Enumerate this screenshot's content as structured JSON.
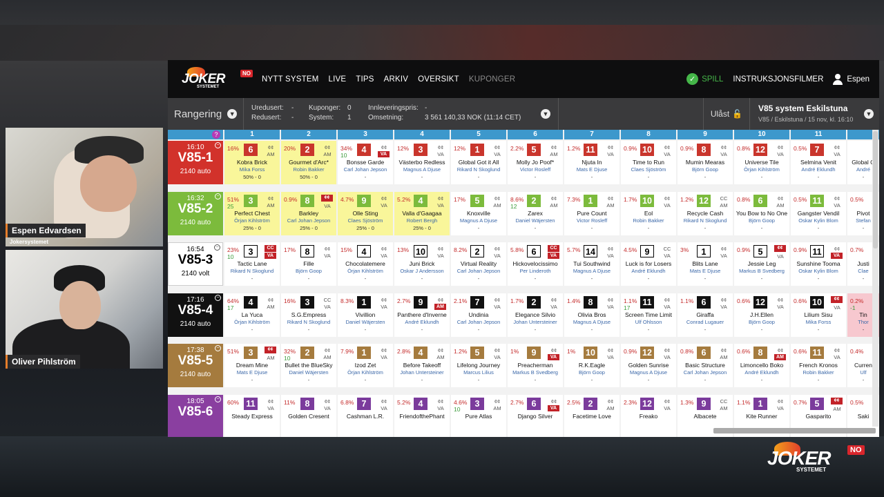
{
  "topbar": {
    "logo_text": "JOKER",
    "logo_sub": "SYSTEMET",
    "logo_badge": "NO",
    "nav": [
      "NYTT SYSTEM",
      "LIVE",
      "TIPS",
      "ARKIV",
      "OVERSIKT",
      "KUPONGER"
    ],
    "spill": "SPILL",
    "instr": "INSTRUKSJONSFILMER",
    "user": "Espen"
  },
  "subbar": {
    "rangering": "Rangering",
    "stats": {
      "uredusert_k": "Uredusert:",
      "uredusert_v": "-",
      "redusert_k": "Redusert:",
      "redusert_v": "-",
      "kuponger_k": "Kuponger:",
      "kuponger_v": "0",
      "system_k": "System:",
      "system_v": "1",
      "innlev_k": "Innleveringspris:",
      "innlev_v": "-",
      "oms_k": "Omsetning:",
      "oms_v": "3 561 140,33 NOK (11:14 CET)"
    },
    "ulast": "Ulåst",
    "system_title": "V85 system Eskilstuna",
    "system_sub": "V85 / Eskilstuna / 15 nov, kl. 16:10"
  },
  "columns": [
    "1",
    "2",
    "3",
    "4",
    "5",
    "6",
    "7",
    "8",
    "9",
    "10",
    "11"
  ],
  "qmark": "?",
  "races": [
    {
      "time": "16:10",
      "name": "V85-1",
      "dist": "2140 auto",
      "color": "#d2322b",
      "cells": [
        {
          "pct": "16%",
          "num": "6",
          "nc": "#c9352c",
          "sh": "¢¢ AM",
          "hn": "Kobra Brick",
          "dn": "Mika Forss",
          "ex": "50% - 0",
          "bg": "y"
        },
        {
          "pct": "20%",
          "num": "2",
          "nc": "#c9352c",
          "sh": "¢¢ AM",
          "hn": "Gourmet d'Arc*",
          "dn": "Robin Bakker",
          "ex": "50% - 0",
          "bg": "y"
        },
        {
          "pct": "34%",
          "pct2": "10",
          "num": "4",
          "nc": "#c9352c",
          "sh": "¢¢",
          "tag": "VA",
          "hn": "Bonsse Garde",
          "dn": "Carl Johan Jepson",
          "ex": "-"
        },
        {
          "pct": "12%",
          "num": "3",
          "nc": "#c9352c",
          "sh": "¢¢ VA",
          "hn": "Västerbo Redless",
          "dn": "Magnus A Djuse",
          "ex": "-"
        },
        {
          "pct": "12%",
          "num": "1",
          "nc": "#c9352c",
          "sh": "¢¢ VA",
          "hn": "Global Got it All",
          "dn": "Rikard N Skoglund",
          "ex": "-"
        },
        {
          "pct": "2.2%",
          "num": "5",
          "nc": "#c9352c",
          "sh": "¢¢ AM",
          "hn": "Molly Jo Poof*",
          "dn": "Victor Rosleff",
          "ex": "-"
        },
        {
          "pct": "1.2%",
          "num": "11",
          "nc": "#c9352c",
          "sh": "¢¢ VA",
          "hn": "Njuta In",
          "dn": "Mats E Djuse",
          "ex": "-"
        },
        {
          "pct": "0.9%",
          "num": "10",
          "nc": "#c9352c",
          "sh": "¢¢ VA",
          "hn": "Time to Run",
          "dn": "Claes Sjöström",
          "ex": "-"
        },
        {
          "pct": "0.9%",
          "num": "8",
          "nc": "#c9352c",
          "sh": "¢¢ VA",
          "hn": "Mumin Mearas",
          "dn": "Björn Goop",
          "ex": "-"
        },
        {
          "pct": "0.8%",
          "num": "12",
          "nc": "#c9352c",
          "sh": "¢¢ VA",
          "hn": "Universe Tile",
          "dn": "Örjan Kihlström",
          "ex": "-"
        },
        {
          "pct": "0.5%",
          "num": "7",
          "nc": "#c9352c",
          "sh": "¢¢ VA",
          "hn": "Selmina Venit",
          "dn": "André Eklundh",
          "ex": "-"
        },
        {
          "pct": "",
          "num": "",
          "nc": "#c9352c",
          "sh": "",
          "hn": "Global G",
          "dn": "André",
          "ex": "-"
        }
      ]
    },
    {
      "time": "16:32",
      "name": "V85-2",
      "dist": "2140 auto",
      "color": "#7cbb3c",
      "cells": [
        {
          "pct": "51%",
          "pct2": "25",
          "num": "3",
          "nc": "#7cbb3c",
          "sh": "¢¢ AM",
          "hn": "Perfect Chest",
          "dn": "Örjan Kihlström",
          "ex": "25% - 0",
          "bg": "y"
        },
        {
          "pct": "0.9%",
          "num": "8",
          "nc": "#7cbb3c",
          "tagt": "¢¢",
          "sh": "",
          "tag2": "VA",
          "hn": "Barkley",
          "dn": "Carl Johan Jepson",
          "ex": "25% - 0",
          "bg": "y"
        },
        {
          "pct": "4.7%",
          "num": "9",
          "nc": "#7cbb3c",
          "sh": "¢¢ VA",
          "hn": "Olle Sting",
          "dn": "Claes Sjöström",
          "ex": "25% - 0",
          "bg": "y"
        },
        {
          "pct": "5.2%",
          "num": "4",
          "nc": "#7cbb3c",
          "sh": "¢¢ VA",
          "hn": "Valla d'Gaagaa",
          "dn": "Robert Bergh",
          "ex": "25% - 0",
          "bg": "y"
        },
        {
          "pct": "17%",
          "num": "5",
          "nc": "#7cbb3c",
          "sh": "¢¢ AM",
          "hn": "Knoxville",
          "dn": "Magnus A Djuse",
          "ex": "-"
        },
        {
          "pct": "8.6%",
          "pct2": "12",
          "num": "2",
          "nc": "#7cbb3c",
          "sh": "¢¢ AM",
          "hn": "Zarex",
          "dn": "Daniel Wäjersten",
          "ex": "-"
        },
        {
          "pct": "7.3%",
          "num": "1",
          "nc": "#7cbb3c",
          "sh": "¢¢ AM",
          "hn": "Pure Count",
          "dn": "Victor Rosleff",
          "ex": "-"
        },
        {
          "pct": "1.7%",
          "num": "10",
          "nc": "#7cbb3c",
          "sh": "¢¢ VA",
          "hn": "Eol",
          "dn": "Robin Bakker",
          "ex": "-"
        },
        {
          "pct": "1.2%",
          "num": "12",
          "nc": "#7cbb3c",
          "sh": "CC AM",
          "hn": "Recycle Cash",
          "dn": "Rikard N Skoglund",
          "ex": "-"
        },
        {
          "pct": "0.8%",
          "num": "6",
          "nc": "#7cbb3c",
          "sh": "¢¢ AM",
          "hn": "You Bow to No One",
          "dn": "Björn Goop",
          "ex": "-"
        },
        {
          "pct": "0.5%",
          "num": "11",
          "nc": "#7cbb3c",
          "sh": "¢¢ VA",
          "hn": "Gangster Vendil",
          "dn": "Oskar Kylin Blom",
          "ex": "-"
        },
        {
          "pct": "0.5%",
          "num": "",
          "nc": "#7cbb3c",
          "sh": "",
          "hn": "Pivot",
          "dn": "Stefan",
          "ex": "-"
        }
      ]
    },
    {
      "time": "16:54",
      "name": "V85-3",
      "dist": "2140 volt",
      "color": "#ffffff",
      "tc": "#000",
      "cells": [
        {
          "pct": "23%",
          "pct2": "10",
          "num": "3",
          "nc": "w",
          "tagt": "CC",
          "tag": "VA",
          "hn": "Tactic Lane",
          "dn": "Rikard N Skoglund",
          "ex": "-"
        },
        {
          "pct": "17%",
          "num": "8",
          "nc": "w",
          "sh": "¢¢ VA",
          "hn": "Fille",
          "dn": "Björn Goop",
          "ex": "-"
        },
        {
          "pct": "15%",
          "num": "4",
          "nc": "w",
          "sh": "¢¢ VA",
          "hn": "Chocolatemere",
          "dn": "Örjan Kihlström",
          "ex": "-"
        },
        {
          "pct": "13%",
          "num": "10",
          "nc": "w",
          "sh": "¢¢ VA",
          "hn": "Juni Brick",
          "dn": "Oskar J Andersson",
          "ex": "-"
        },
        {
          "pct": "8.2%",
          "num": "2",
          "nc": "w",
          "sh": "¢¢ VA",
          "hn": "Virtual Reality",
          "dn": "Carl Johan Jepson",
          "ex": "-"
        },
        {
          "pct": "5.8%",
          "num": "6",
          "nc": "w",
          "tagt": "CC",
          "tag": "VA",
          "hn": "Hickovelocissimo",
          "dn": "Per Linderoth",
          "ex": "-"
        },
        {
          "pct": "5.7%",
          "num": "14",
          "nc": "w",
          "sh": "¢¢ VA",
          "hn": "Tui Southwind",
          "dn": "Magnus A Djuse",
          "ex": "-"
        },
        {
          "pct": "4.5%",
          "num": "9",
          "nc": "w",
          "sh": "CC VA",
          "hn": "Luck is for Losers",
          "dn": "André Eklundh",
          "ex": "-"
        },
        {
          "pct": "3%",
          "num": "1",
          "nc": "w",
          "sh": "¢¢ VA",
          "hn": "Blits Lane",
          "dn": "Mats E Djuse",
          "ex": "-"
        },
        {
          "pct": "0.9%",
          "num": "5",
          "nc": "w",
          "tagt": "¢¢",
          "tag2": "VA",
          "hn": "Jessie Leg",
          "dn": "Markus B Svedberg",
          "ex": "-"
        },
        {
          "pct": "0.9%",
          "num": "11",
          "nc": "w",
          "sh": "¢¢",
          "tag": "VA",
          "hn": "Sunshine Tooma",
          "dn": "Oskar Kylin Blom",
          "ex": "-"
        },
        {
          "pct": "0.7%",
          "num": "",
          "nc": "w",
          "sh": "",
          "hn": "Justi",
          "dn": "Clae",
          "ex": "-"
        }
      ]
    },
    {
      "time": "17:16",
      "name": "V85-4",
      "dist": "2140 auto",
      "color": "#111111",
      "cells": [
        {
          "pct": "64%",
          "pct2": "17",
          "num": "4",
          "nc": "#111",
          "sh": "¢¢ AM",
          "hn": "La Yuca",
          "dn": "Örjan Kihlström",
          "ex": "-"
        },
        {
          "pct": "16%",
          "num": "3",
          "nc": "#111",
          "sh": "CC VA",
          "hn": "S.G.Empress",
          "dn": "Rikard N Skoglund",
          "ex": "-"
        },
        {
          "pct": "8.3%",
          "num": "1",
          "nc": "#111",
          "sh": "¢¢ VA",
          "hn": "Vivillion",
          "dn": "Daniel Wäjersten",
          "ex": "-"
        },
        {
          "pct": "2.7%",
          "num": "9",
          "nc": "#111",
          "sh": "¢¢",
          "tag": "AM",
          "hn": "Panthere d'Inverne",
          "dn": "André Eklundh",
          "ex": "-"
        },
        {
          "pct": "2.1%",
          "num": "7",
          "nc": "#111",
          "sh": "¢¢ VA",
          "hn": "Undinia",
          "dn": "Carl Johan Jepson",
          "ex": "-"
        },
        {
          "pct": "1.7%",
          "num": "2",
          "nc": "#111",
          "sh": "¢¢ VA",
          "hn": "Elegance Silvio",
          "dn": "Johan Untersteiner",
          "ex": "-"
        },
        {
          "pct": "1.4%",
          "num": "8",
          "nc": "#111",
          "sh": "¢¢ VA",
          "hn": "Olivia Bros",
          "dn": "Magnus A Djuse",
          "ex": "-"
        },
        {
          "pct": "1.1%",
          "pct2": "17",
          "num": "11",
          "nc": "#111",
          "sh": "¢¢ VA",
          "hn": "Screen Time Limit",
          "dn": "Ulf Ohlsson",
          "ex": "-"
        },
        {
          "pct": "1.1%",
          "num": "6",
          "nc": "#111",
          "sh": "¢¢ VA",
          "hn": "Giraffa",
          "dn": "Conrad Lugauer",
          "ex": "-"
        },
        {
          "pct": "0.6%",
          "num": "12",
          "nc": "#111",
          "sh": "¢¢ VA",
          "hn": "J.H.Ellen",
          "dn": "Björn Goop",
          "ex": "-"
        },
        {
          "pct": "0.6%",
          "num": "10",
          "nc": "#111",
          "tagt": "¢¢",
          "tag2": "VA",
          "hn": "Lilium Sisu",
          "dn": "Mika Forss",
          "ex": "-"
        },
        {
          "pct": "0.2%",
          "pct2": "-1",
          "num": "",
          "nc": "#111",
          "sh": "",
          "hn": "Tin",
          "dn": "Thor",
          "ex": "-",
          "bg": "p"
        }
      ]
    },
    {
      "time": "17:38",
      "name": "V85-5",
      "dist": "2140 auto",
      "color": "#a57b3e",
      "cells": [
        {
          "pct": "51%",
          "num": "3",
          "nc": "#a57b3e",
          "tagt": "¢¢",
          "tag2": "AM",
          "hn": "Dream Mine",
          "dn": "Mats E Djuse",
          "ex": "-"
        },
        {
          "pct": "32%",
          "pct2": "10",
          "num": "2",
          "nc": "#a57b3e",
          "sh": "¢¢ AM",
          "hn": "Bullet the BlueSky",
          "dn": "Daniel Wäjersten",
          "ex": "-"
        },
        {
          "pct": "7.9%",
          "num": "1",
          "nc": "#a57b3e",
          "sh": "¢¢ VA",
          "hn": "Izod Zet",
          "dn": "Örjan Kihlström",
          "ex": "-"
        },
        {
          "pct": "2.8%",
          "num": "4",
          "nc": "#a57b3e",
          "sh": "¢¢ AM",
          "hn": "Before Takeoff",
          "dn": "Johan Untersteiner",
          "ex": "-"
        },
        {
          "pct": "1.2%",
          "num": "5",
          "nc": "#a57b3e",
          "sh": "¢¢ VA",
          "hn": "Lifelong Journey",
          "dn": "Marcus Lilius",
          "ex": "-"
        },
        {
          "pct": "1%",
          "num": "9",
          "nc": "#a57b3e",
          "sh": "¢¢",
          "tag": "VA",
          "hn": "Preacherman",
          "dn": "Markus B Svedberg",
          "ex": "-"
        },
        {
          "pct": "1%",
          "num": "10",
          "nc": "#a57b3e",
          "sh": "¢¢ VA",
          "hn": "R.K.Eagle",
          "dn": "Björn Goop",
          "ex": "-"
        },
        {
          "pct": "0.9%",
          "num": "12",
          "nc": "#a57b3e",
          "sh": "¢¢ VA",
          "hn": "Golden Sunrise",
          "dn": "Magnus A Djuse",
          "ex": "-"
        },
        {
          "pct": "0.8%",
          "num": "6",
          "nc": "#a57b3e",
          "sh": "¢¢ AM",
          "hn": "Basic Structure",
          "dn": "Carl Johan Jepson",
          "ex": "-"
        },
        {
          "pct": "0.6%",
          "num": "8",
          "nc": "#a57b3e",
          "sh": "¢¢",
          "tag": "AM",
          "hn": "Limoncello Boko",
          "dn": "André Eklundh",
          "ex": "-"
        },
        {
          "pct": "0.6%",
          "num": "11",
          "nc": "#a57b3e",
          "sh": "¢¢ VA",
          "hn": "French Kronos",
          "dn": "Robin Bakker",
          "ex": "-"
        },
        {
          "pct": "0.4%",
          "num": "",
          "nc": "#a57b3e",
          "sh": "",
          "hn": "Curren",
          "dn": "Ulf",
          "ex": "-"
        }
      ]
    },
    {
      "time": "18:05",
      "name": "V85-6",
      "dist": "",
      "color": "#8a3fa0",
      "cells": [
        {
          "pct": "60%",
          "num": "11",
          "nc": "#7b3b9c",
          "sh": "¢¢ VA",
          "hn": "Steady Express",
          "dn": "",
          "ex": ""
        },
        {
          "pct": "11%",
          "num": "8",
          "nc": "#7b3b9c",
          "sh": "¢¢ VA",
          "hn": "Golden Cresent",
          "dn": "",
          "ex": ""
        },
        {
          "pct": "6.8%",
          "num": "7",
          "nc": "#7b3b9c",
          "sh": "¢¢ VA",
          "hn": "Cashman L.R.",
          "dn": "",
          "ex": ""
        },
        {
          "pct": "5.2%",
          "num": "4",
          "nc": "#7b3b9c",
          "sh": "¢¢ VA",
          "hn": "FriendofthePhant",
          "dn": "",
          "ex": ""
        },
        {
          "pct": "4.6%",
          "pct2": "10",
          "num": "3",
          "nc": "#7b3b9c",
          "sh": "¢¢ AM",
          "hn": "Pure Atlas",
          "dn": "",
          "ex": ""
        },
        {
          "pct": "2.7%",
          "num": "6",
          "nc": "#7b3b9c",
          "sh": "¢¢",
          "tag": "VA",
          "hn": "Django Silver",
          "dn": "",
          "ex": ""
        },
        {
          "pct": "2.5%",
          "num": "2",
          "nc": "#7b3b9c",
          "sh": "¢¢ AM",
          "hn": "Facetime Love",
          "dn": "",
          "ex": ""
        },
        {
          "pct": "2.3%",
          "num": "12",
          "nc": "#7b3b9c",
          "sh": "¢¢ VA",
          "hn": "Freako",
          "dn": "",
          "ex": ""
        },
        {
          "pct": "1.3%",
          "num": "9",
          "nc": "#7b3b9c",
          "sh": "CC AM",
          "hn": "Albacete",
          "dn": "",
          "ex": ""
        },
        {
          "pct": "1.1%",
          "num": "1",
          "nc": "#7b3b9c",
          "sh": "¢¢ VA",
          "hn": "Kite Runner",
          "dn": "",
          "ex": ""
        },
        {
          "pct": "0.7%",
          "num": "5",
          "nc": "#7b3b9c",
          "tagt": "¢¢",
          "tag2": "AM",
          "hn": "Gasparito",
          "dn": "",
          "ex": ""
        },
        {
          "pct": "0.5%",
          "num": "",
          "nc": "#7b3b9c",
          "sh": "",
          "hn": "Saki",
          "dn": "",
          "ex": ""
        }
      ]
    }
  ],
  "cams": [
    {
      "name": "Espen Edvardsen",
      "sub": "Jokersystemet"
    },
    {
      "name": "Oliver Pihlström",
      "sub": ""
    }
  ],
  "watermark": {
    "text": "JOKER",
    "sub": "SYSTEMET",
    "badge": "NO"
  }
}
